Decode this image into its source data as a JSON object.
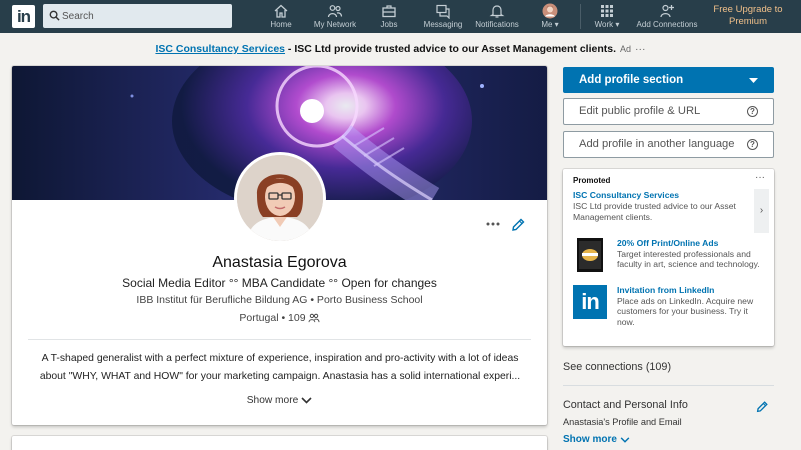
{
  "nav": {
    "logo": "in",
    "search_placeholder": "Search",
    "items": [
      {
        "label": "Home",
        "icon": "home-icon"
      },
      {
        "label": "My Network",
        "icon": "network-icon"
      },
      {
        "label": "Jobs",
        "icon": "briefcase-icon"
      },
      {
        "label": "Messaging",
        "icon": "messaging-icon"
      },
      {
        "label": "Notifications",
        "icon": "bell-icon"
      },
      {
        "label": "Me",
        "icon": "avatar-icon"
      },
      {
        "label": "Work",
        "icon": "grid-icon"
      },
      {
        "label": "Add Connections",
        "icon": "add-person-icon"
      }
    ],
    "premium": "Free Upgrade to Premium"
  },
  "ad_banner": {
    "link": "ISC Consultancy Services",
    "text": " - ISC Ltd provide trusted advice to our Asset Management clients.",
    "ad_label": "Ad",
    "dots": "···"
  },
  "profile": {
    "name": "Anastasia Egorova",
    "headline": "Social Media Editor °° MBA Candidate °° Open for changes",
    "education": "IBB Institut für Berufliche Bildung AG • Porto Business School",
    "location": "Portugal • 109",
    "summary": "A T-shaped generalist with a perfect mixture of experience, inspiration and pro-activity with a lot of ideas about \"WHY, WHAT and HOW\" for your marketing campaign. Anastasia has a solid international experi...",
    "show_more": "Show more"
  },
  "right_rail": {
    "add_section": "Add profile section",
    "edit_public": "Edit public profile & URL",
    "add_language": "Add profile in another language",
    "help_glyph": "?",
    "promoted": {
      "title": "Promoted",
      "dots": "···",
      "main_title": "ISC Consultancy Services",
      "main_text": "ISC Ltd provide trusted advice to our Asset Management clients.",
      "arrow": "›",
      "items": [
        {
          "title": "20% Off Print/Online Ads",
          "text": "Target interested professionals and faculty in art, science and technology."
        },
        {
          "title": "Invitation from LinkedIn",
          "text": "Place ads on LinkedIn. Acquire new customers for your business. Try it now."
        }
      ]
    },
    "see_connections": "See connections (109)",
    "contact_title": "Contact and Personal Info",
    "contact_sub": "Anastasia's Profile and Email",
    "show_more": "Show more"
  },
  "colors": {
    "nav_bg": "#283e4a",
    "accent": "#0073b1",
    "premium": "#f1c08a",
    "page_bg": "#f3f2ef"
  }
}
